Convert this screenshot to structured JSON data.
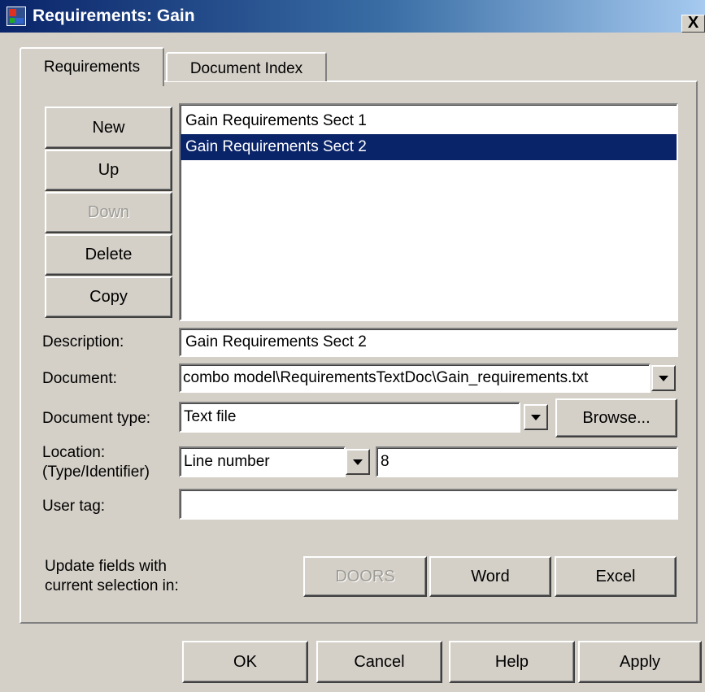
{
  "window": {
    "title": "Requirements: Gain",
    "close_label": "X"
  },
  "tabs": [
    {
      "label": "Requirements",
      "active": true
    },
    {
      "label": "Document Index",
      "active": false
    }
  ],
  "side_buttons": {
    "new": "New",
    "up": "Up",
    "down": "Down",
    "delete": "Delete",
    "copy": "Copy"
  },
  "requirements_list": {
    "items": [
      "Gain Requirements Sect 1",
      "Gain Requirements Sect 2"
    ],
    "selected_index": 1
  },
  "form": {
    "description_label": "Description:",
    "description_value": "Gain Requirements Sect 2",
    "document_label": "Document:",
    "document_value": "combo model\\RequirementsTextDoc\\Gain_requirements.txt",
    "document_type_label": "Document type:",
    "document_type_value": "Text file",
    "browse_label": "Browse...",
    "location_label_line1": "Location:",
    "location_label_line2": "(Type/Identifier)",
    "location_type_value": "Line number",
    "location_id_value": "8",
    "user_tag_label": "User tag:",
    "user_tag_value": ""
  },
  "update": {
    "label_line1": "Update fields with",
    "label_line2": "current selection in:",
    "doors": "DOORS",
    "word": "Word",
    "excel": "Excel"
  },
  "footer": {
    "ok": "OK",
    "cancel": "Cancel",
    "help": "Help",
    "apply": "Apply"
  },
  "colors": {
    "dialog_bg": "#d4d0c8",
    "titlebar_start": "#0a246a",
    "titlebar_end": "#a6caf0",
    "selection": "#0a246a",
    "disabled_text": "#9c9a94"
  },
  "icons": {
    "title": "simulink-model-icon",
    "dropdown": "chevron-down-icon"
  }
}
